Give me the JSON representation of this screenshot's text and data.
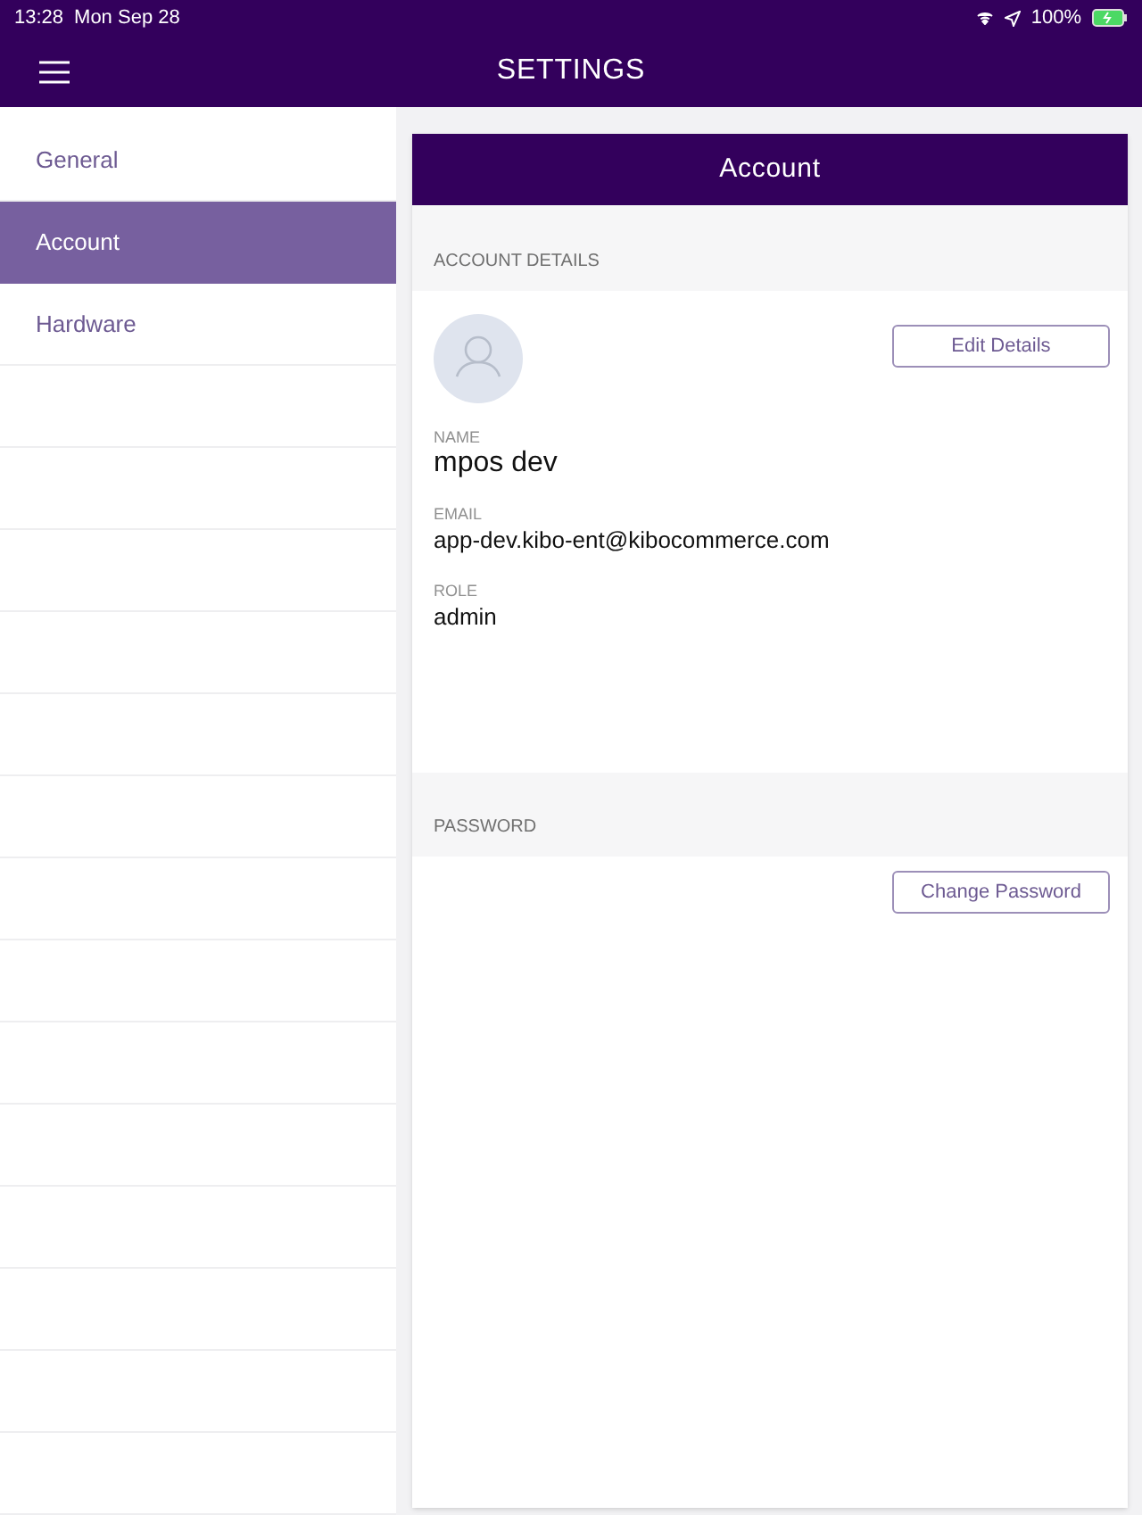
{
  "status_bar": {
    "time": "13:28",
    "date": "Mon Sep 28",
    "battery": "100%"
  },
  "header": {
    "title": "SETTINGS"
  },
  "sidebar": {
    "items": [
      {
        "label": "General",
        "selected": false
      },
      {
        "label": "Account",
        "selected": true
      },
      {
        "label": "Hardware",
        "selected": false
      }
    ]
  },
  "panel": {
    "title": "Account",
    "sections": [
      {
        "heading": "ACCOUNT DETAILS",
        "button": "Edit Details",
        "fields": [
          {
            "label": "NAME",
            "value": "mpos dev",
            "kind": "large"
          },
          {
            "label": "EMAIL",
            "value": "app-dev.kibo-ent@kibocommerce.com",
            "kind": "normal"
          },
          {
            "label": "ROLE",
            "value": "admin",
            "kind": "normal"
          }
        ]
      },
      {
        "heading": "PASSWORD",
        "button": "Change Password"
      }
    ]
  }
}
